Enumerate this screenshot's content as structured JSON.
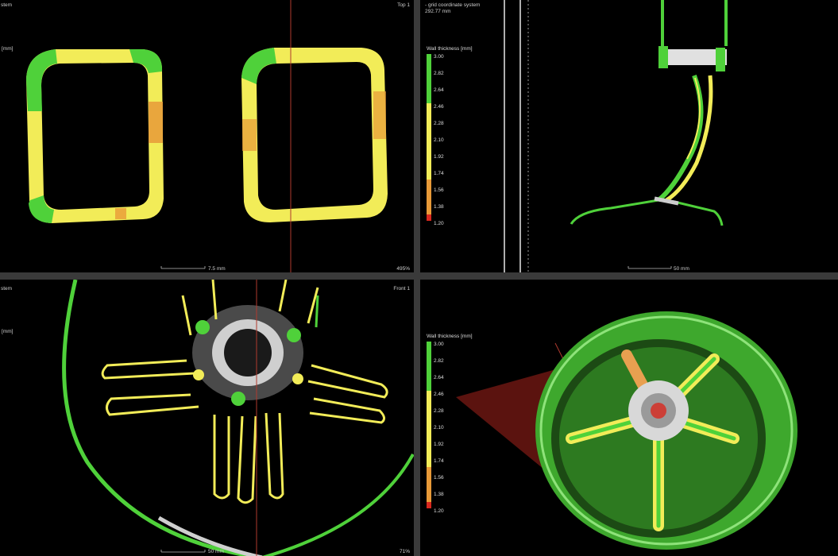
{
  "views": {
    "top_left": {
      "label_top_left": "stem",
      "label_top_right": "Top 1",
      "unit_label": "[mm]",
      "scale_label": "7.5 mm",
      "zoom": "495%"
    },
    "top_right": {
      "label_top_left": "- grid coordinate system",
      "measure": "292.77 mm",
      "scale_label": "50 mm"
    },
    "bottom_left": {
      "label_top_left": "stem",
      "label_top_right": "Front 1",
      "unit_label": "[mm]",
      "scale_label": "50 mm",
      "zoom": "71%"
    }
  },
  "legend": {
    "title": "Wall thickness [mm]",
    "ticks": [
      "3.00",
      "2.82",
      "2.64",
      "2.46",
      "2.28",
      "2.10",
      "1.92",
      "1.74",
      "1.56",
      "1.38",
      "1.20"
    ],
    "colors": {
      "green": "#4fd13a",
      "yellow": "#f2ec58",
      "orange": "#e89a38",
      "red": "#d8281e"
    }
  }
}
